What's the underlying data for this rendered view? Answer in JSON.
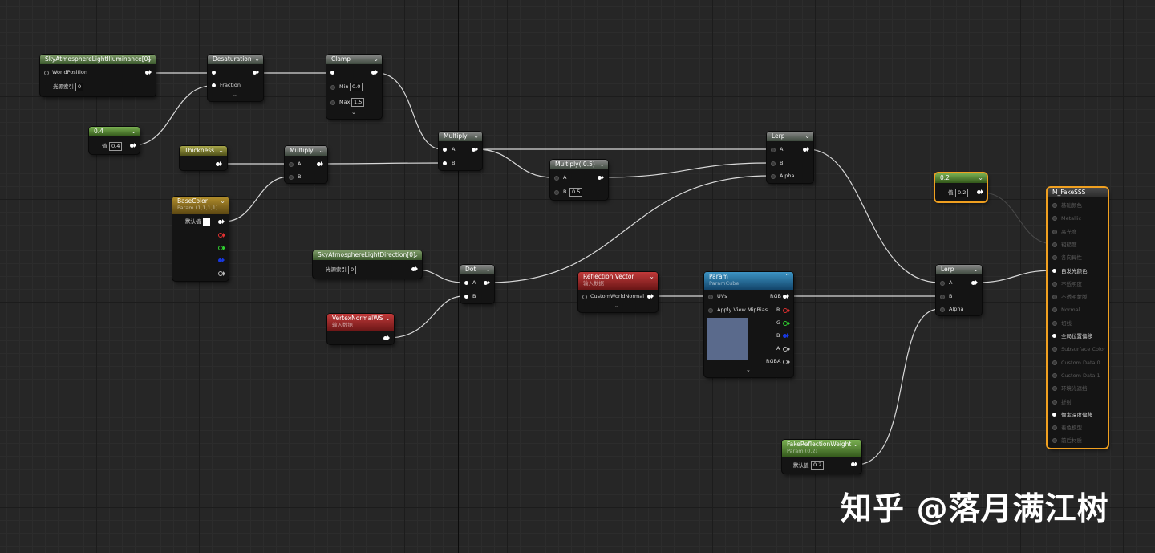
{
  "nodes": {
    "sky_illum": {
      "title": "SkyAtmosphereLightIlluminance[0]",
      "pin_world": "WorldPosition",
      "light_index_label": "光源索引",
      "light_index_value": "0"
    },
    "desat": {
      "title": "Desaturation",
      "fraction": "Fraction"
    },
    "clamp": {
      "title": "Clamp",
      "min_label": "Min",
      "min_value": "0.0",
      "max_label": "Max",
      "max_value": "1.5"
    },
    "const04": {
      "title": "0.4",
      "value_label": "值",
      "value": "0.4"
    },
    "thickness": {
      "title": "Thickness"
    },
    "multiply1": {
      "title": "Multiply",
      "a": "A",
      "b": "B"
    },
    "multiply2": {
      "title": "Multiply",
      "a": "A",
      "b": "B"
    },
    "basecolor": {
      "title": "BaseColor",
      "subtitle": "Param (1,1,1,1)",
      "default_label": "默认值"
    },
    "multiply05": {
      "title": "Multiply(,0.5)",
      "a": "A",
      "b": "B",
      "b_value": "0.5"
    },
    "lerp1": {
      "title": "Lerp",
      "a": "A",
      "b": "B",
      "alpha": "Alpha"
    },
    "sky_dir": {
      "title": "SkyAtmosphereLightDirection[0]",
      "light_index_label": "光源索引",
      "light_index_value": "0"
    },
    "dot": {
      "title": "Dot",
      "a": "A",
      "b": "B"
    },
    "vertex_normal": {
      "title": "VertexNormalWS",
      "subtitle": "输入数据"
    },
    "reflection": {
      "title": "Reflection Vector",
      "subtitle": "输入数据",
      "pin": "CustomWorldNormal"
    },
    "param_cube": {
      "title": "Param",
      "subtitle": "ParamCube",
      "uvs": "UVs",
      "mip": "Apply View MipBias",
      "rgb": "RGB",
      "r": "R",
      "g": "G",
      "b": "B",
      "a": "A",
      "rgba": "RGBA"
    },
    "const02": {
      "title": "0.2",
      "value_label": "值",
      "value": "0.2"
    },
    "lerp2": {
      "title": "Lerp",
      "a": "A",
      "b": "B",
      "alpha": "Alpha"
    },
    "fake_weight": {
      "title": "FakeReflectionWeight",
      "subtitle": "Param (0.2)",
      "default_label": "默认值",
      "value": "0.2"
    },
    "material": {
      "title": "M_FakeSSS",
      "pins": [
        {
          "label": "基础颜色",
          "active": false
        },
        {
          "label": "Metallic",
          "active": false
        },
        {
          "label": "高光度",
          "active": false
        },
        {
          "label": "粗糙度",
          "active": false
        },
        {
          "label": "各向异性",
          "active": false
        },
        {
          "label": "自发光颜色",
          "active": true
        },
        {
          "label": "不透明度",
          "active": false
        },
        {
          "label": "不透明蒙版",
          "active": false
        },
        {
          "label": "Normal",
          "active": false
        },
        {
          "label": "切线",
          "active": false
        },
        {
          "label": "全局位置偏移",
          "active": true
        },
        {
          "label": "Subsurface Color",
          "active": false
        },
        {
          "label": "Custom Data 0",
          "active": false
        },
        {
          "label": "Custom Data 1",
          "active": false
        },
        {
          "label": "环境光遮挡",
          "active": false
        },
        {
          "label": "折射",
          "active": false
        },
        {
          "label": "像素深度偏移",
          "active": true
        },
        {
          "label": "着色模型",
          "active": false
        },
        {
          "label": "前后材质",
          "active": false
        }
      ]
    }
  },
  "colors": {
    "wire": "#d8d8d8",
    "selected_outline": "#f0a020",
    "material_header": "#4a4a4a"
  },
  "watermark": {
    "text": "知乎 @落月满江树"
  }
}
